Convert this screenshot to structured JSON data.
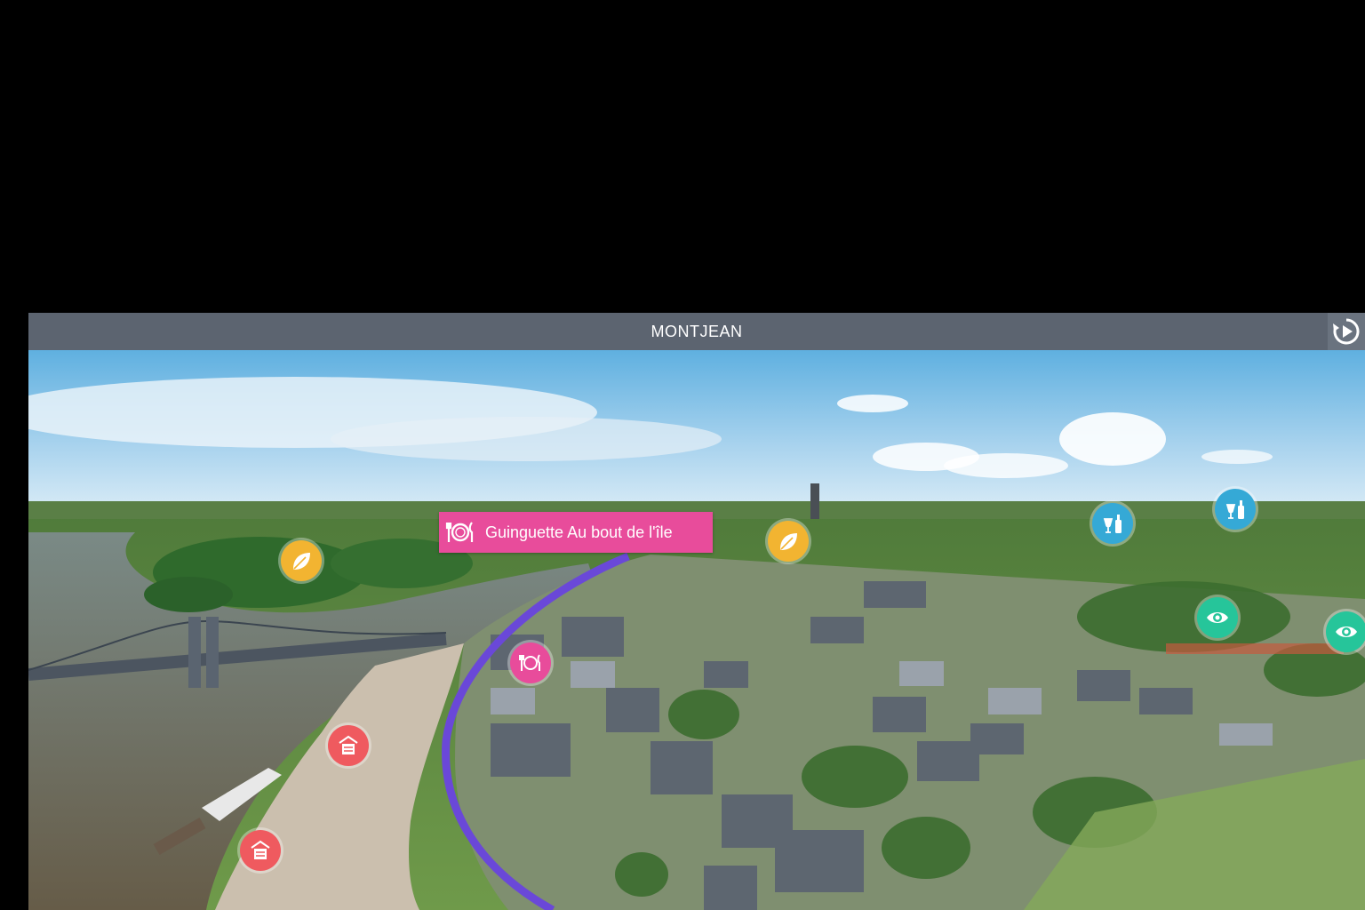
{
  "header": {
    "title": "MONTJEAN",
    "replay_icon": "replay-icon"
  },
  "tooltip": {
    "label": "Guinguette Au bout de l'île",
    "icon": "restaurant-icon"
  },
  "pois": [
    {
      "category": "nature",
      "icon": "leaf-icon",
      "color": "#f2b431"
    },
    {
      "category": "nature",
      "icon": "leaf-icon",
      "color": "#f2b431"
    },
    {
      "category": "restaurant",
      "icon": "restaurant-icon",
      "color": "#e84c9b"
    },
    {
      "category": "wine",
      "icon": "wine-icon",
      "color": "#35a9d6"
    },
    {
      "category": "wine",
      "icon": "wine-icon",
      "color": "#35a9d6"
    },
    {
      "category": "viewpoint",
      "icon": "eye-icon",
      "color": "#26c59a"
    },
    {
      "category": "viewpoint",
      "icon": "eye-icon",
      "color": "#26c59a"
    },
    {
      "category": "lodging",
      "icon": "lodging-icon",
      "color": "#ef5a5f"
    },
    {
      "category": "lodging",
      "icon": "lodging-icon",
      "color": "#ef5a5f"
    }
  ],
  "colors": {
    "titlebar": "#5c6470",
    "route": "#6a48d8"
  }
}
